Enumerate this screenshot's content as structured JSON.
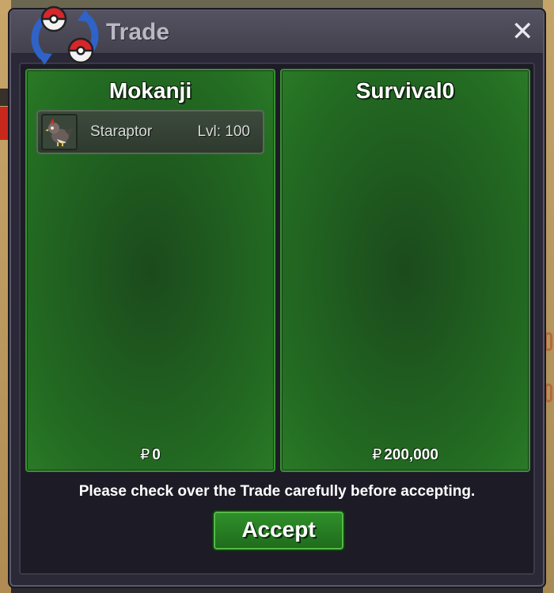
{
  "window": {
    "title": "Trade",
    "close_glyph": "✕"
  },
  "trade": {
    "left": {
      "player_name": "Mokanji",
      "pokemon": [
        {
          "name": "Staraptor",
          "level_text": "Lvl: 100",
          "sprite_icon": "staraptor-sprite-icon"
        }
      ],
      "money_symbol": "₽",
      "money": "0"
    },
    "right": {
      "player_name": "Survival0",
      "pokemon": [],
      "money_symbol": "₽",
      "money": "200,000"
    }
  },
  "notice_text": "Please check over the Trade carefully before accepting.",
  "accept_label": "Accept",
  "colors": {
    "panel_green": "#236b22",
    "panel_border": "#3b8f35",
    "window_bg": "#2b2838",
    "button_green": "#2f8f2a",
    "pokeball_red": "#d8262a",
    "trade_arrow_blue": "#2f63c8"
  }
}
